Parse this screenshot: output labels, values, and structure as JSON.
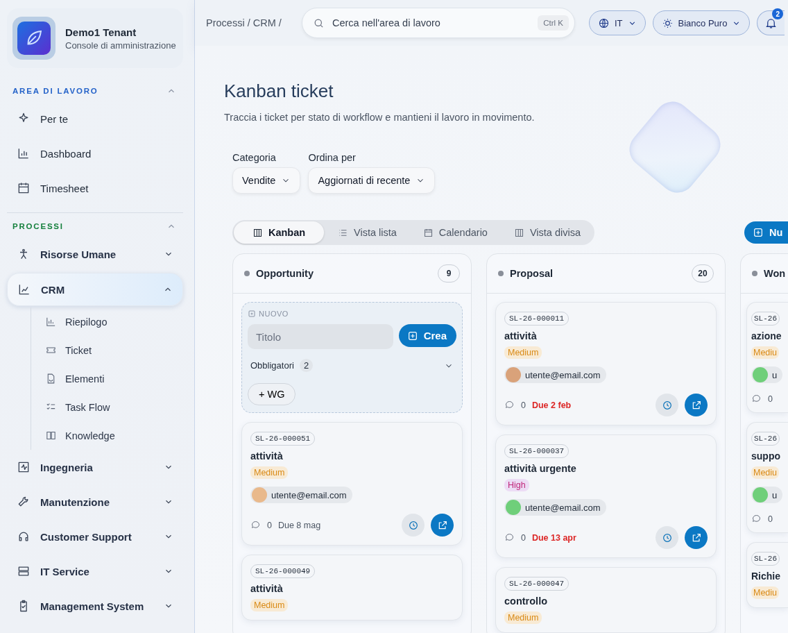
{
  "sidebar": {
    "brand": {
      "name": "Demo1 Tenant",
      "subtitle": "Console di amministrazione"
    },
    "sections": [
      {
        "title": "AREA DI LAVORO",
        "color": "#2563c9",
        "expanded": true,
        "items": [
          {
            "label": "Per te",
            "selected": false
          },
          {
            "label": "Dashboard",
            "selected": false
          },
          {
            "label": "Timesheet",
            "selected": false
          }
        ]
      },
      {
        "title": "PROCESSI",
        "color": "#15803d",
        "expanded": true,
        "items": [
          {
            "label": "Risorse Umane",
            "selected": false,
            "expanded": false
          },
          {
            "label": "CRM",
            "selected": true,
            "expanded": true,
            "children": [
              {
                "label": "Riepilogo"
              },
              {
                "label": "Ticket"
              },
              {
                "label": "Elementi"
              },
              {
                "label": "Task Flow"
              },
              {
                "label": "Knowledge"
              }
            ]
          },
          {
            "label": "Ingegneria",
            "selected": false,
            "expanded": false
          },
          {
            "label": "Manutenzione",
            "selected": false,
            "expanded": false
          },
          {
            "label": "Customer Support",
            "selected": false,
            "expanded": false
          },
          {
            "label": "IT Service",
            "selected": false,
            "expanded": false
          },
          {
            "label": "Management System",
            "selected": false,
            "expanded": false
          }
        ]
      }
    ]
  },
  "topbar": {
    "breadcrumb": "Processi / CRM /",
    "search": {
      "placeholder": "Cerca nell'area di lavoro",
      "shortcut": "Ctrl K"
    },
    "language": "IT",
    "theme": "Bianco Puro",
    "notifications": "2"
  },
  "page": {
    "title": "Kanban ticket",
    "subtitle": "Traccia i ticket per stato di workflow e mantieni il lavoro in movimento."
  },
  "filters": [
    {
      "label": "Categoria",
      "value": "Vendite"
    },
    {
      "label": "Ordina per",
      "value": "Aggiornati di recente"
    }
  ],
  "tabs": [
    {
      "label": "Kanban",
      "selected": true
    },
    {
      "label": "Vista lista",
      "selected": false
    },
    {
      "label": "Calendario",
      "selected": false
    },
    {
      "label": "Vista divisa",
      "selected": false
    }
  ],
  "new_button": "Nu",
  "columns": [
    {
      "title": "Opportunity",
      "count": "9",
      "quick_add": {
        "tag": "NUOVO",
        "placeholder": "Titolo",
        "button": "Crea",
        "required_label": "Obbligatori",
        "required_count": "2",
        "add_button": "+ WG"
      },
      "cards": [
        {
          "id": "SL-26-000051",
          "title": "attività",
          "priority": {
            "label": "Medium",
            "kind": "medium"
          },
          "assignee": {
            "email": "utente@email.com",
            "color": "#e9b98c"
          },
          "comments": "0",
          "due": "Due 8 mag",
          "overdue": false,
          "actions": true
        },
        {
          "id": "SL-26-000049",
          "title": "attività",
          "priority": {
            "label": "Medium",
            "kind": "medium"
          }
        }
      ]
    },
    {
      "title": "Proposal",
      "count": "20",
      "cards": [
        {
          "id": "SL-26-000011",
          "title": "attività",
          "priority": {
            "label": "Medium",
            "kind": "medium"
          },
          "assignee": {
            "email": "utente@email.com",
            "color": "#d9a27a"
          },
          "comments": "0",
          "due": "Due 2 feb",
          "overdue": true,
          "actions": true
        },
        {
          "id": "SL-26-000037",
          "title": "attività urgente",
          "priority": {
            "label": "High",
            "kind": "high"
          },
          "assignee": {
            "email": "utente@email.com",
            "color": "#6fcf7a"
          },
          "comments": "0",
          "due": "Due 13 apr",
          "overdue": true,
          "actions": true
        },
        {
          "id": "SL-26-000047",
          "title": "controllo",
          "priority": {
            "label": "Medium",
            "kind": "medium"
          }
        }
      ]
    },
    {
      "title": "Won",
      "cards": [
        {
          "id": "SL-26",
          "title": "azione",
          "priority": {
            "label": "Mediu",
            "kind": "medium"
          },
          "assignee": {
            "email": "u",
            "color": "#6fcf7a"
          },
          "comments": "0",
          "actions": false
        },
        {
          "id": "SL-26",
          "title": "suppo",
          "priority": {
            "label": "Mediu",
            "kind": "medium"
          },
          "assignee": {
            "email": "u",
            "color": "#6fcf7a"
          },
          "comments": "0",
          "actions": false
        },
        {
          "id": "SL-26",
          "title": "Richie",
          "priority": {
            "label": "Mediu",
            "kind": "medium"
          }
        }
      ]
    }
  ]
}
